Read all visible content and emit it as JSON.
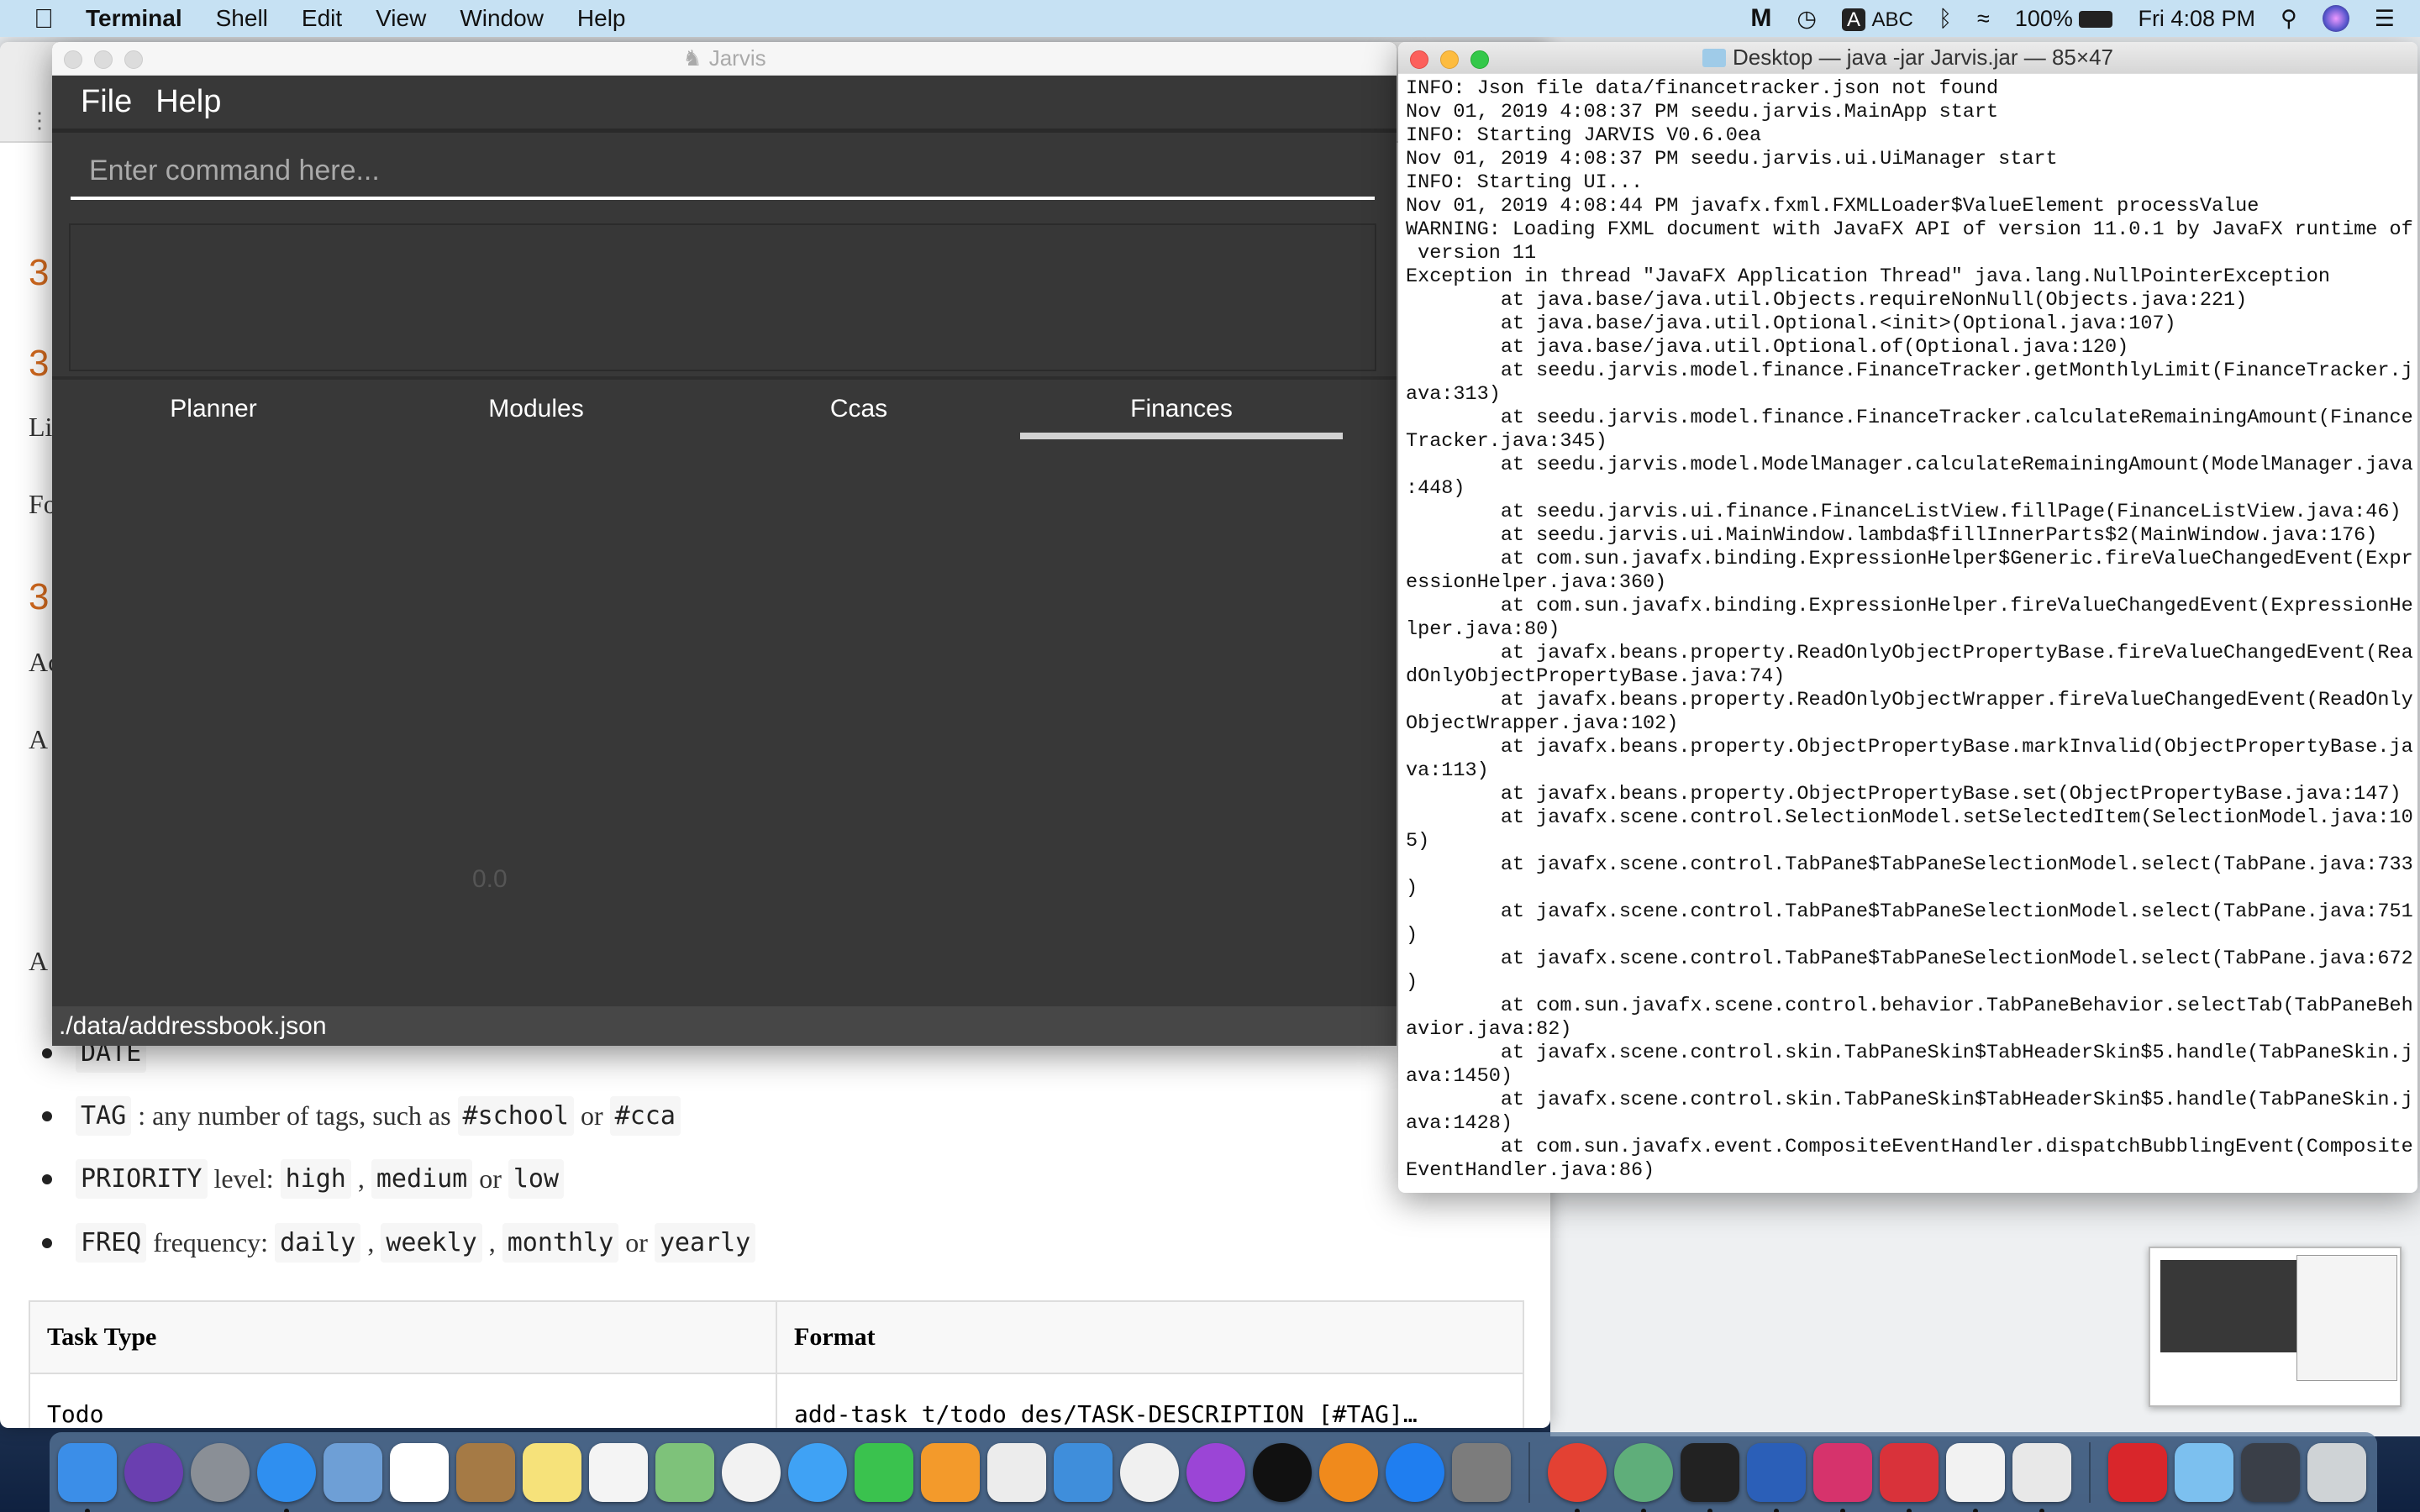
{
  "menubar": {
    "app": "Terminal",
    "items": [
      "Shell",
      "Edit",
      "View",
      "Window",
      "Help"
    ],
    "input_badge": "A",
    "input_source": "ABC",
    "battery": "100%",
    "clock": "Fri 4:08 PM"
  },
  "doc": {
    "partial_lines": [
      {
        "t": "3",
        "h": true
      },
      {
        "t": "3",
        "h": true
      },
      {
        "t": "Li"
      },
      {
        "t": "Fo"
      },
      {
        "t": "3",
        "h": true
      },
      {
        "t": "Ac"
      },
      {
        "t": "A"
      },
      {
        "t": "A"
      }
    ],
    "bullets": [
      [
        {
          "t": "DATE",
          "code": true
        }
      ],
      [
        {
          "t": "TAG",
          "code": true
        },
        {
          "t": " : any number of tags, such as "
        },
        {
          "t": "#school",
          "code": true
        },
        {
          "t": " or "
        },
        {
          "t": "#cca",
          "code": true
        }
      ],
      [
        {
          "t": "PRIORITY",
          "code": true
        },
        {
          "t": " level: "
        },
        {
          "t": "high",
          "code": true
        },
        {
          "t": " , "
        },
        {
          "t": "medium",
          "code": true
        },
        {
          "t": " or "
        },
        {
          "t": "low",
          "code": true
        }
      ],
      [
        {
          "t": "FREQ",
          "code": true
        },
        {
          "t": " frequency: "
        },
        {
          "t": "daily",
          "code": true
        },
        {
          "t": " , "
        },
        {
          "t": "weekly",
          "code": true
        },
        {
          "t": " , "
        },
        {
          "t": "monthly",
          "code": true
        },
        {
          "t": " or "
        },
        {
          "t": "yearly",
          "code": true
        }
      ]
    ],
    "table": {
      "headers": [
        "Task Type",
        "Format"
      ],
      "rows": [
        [
          "Todo",
          "add-task t/todo des/TASK-DESCRIPTION [#TAG]…"
        ]
      ]
    }
  },
  "jarvis": {
    "title": "Jarvis",
    "menu": [
      "File",
      "Help"
    ],
    "command_placeholder": "Enter command here...",
    "tabs": [
      "Planner",
      "Modules",
      "Ccas",
      "Finances"
    ],
    "selected_tab": "Finances",
    "finance_value": "0.0",
    "status_path": "./data/addressbook.json"
  },
  "terminal": {
    "title": "Desktop — java -jar Jarvis.jar — 85×47",
    "lines": [
      "INFO: Json file data/financetracker.json not found",
      "Nov 01, 2019 4:08:37 PM seedu.jarvis.MainApp start",
      "INFO: Starting JARVIS V0.6.0ea",
      "Nov 01, 2019 4:08:37 PM seedu.jarvis.ui.UiManager start",
      "INFO: Starting UI...",
      "Nov 01, 2019 4:08:44 PM javafx.fxml.FXMLLoader$ValueElement processValue",
      "WARNING: Loading FXML document with JavaFX API of version 11.0.1 by JavaFX runtime of",
      " version 11",
      "Exception in thread \"JavaFX Application Thread\" java.lang.NullPointerException",
      "        at java.base/java.util.Objects.requireNonNull(Objects.java:221)",
      "        at java.base/java.util.Optional.<init>(Optional.java:107)",
      "        at java.base/java.util.Optional.of(Optional.java:120)",
      "        at seedu.jarvis.model.finance.FinanceTracker.getMonthlyLimit(FinanceTracker.j",
      "ava:313)",
      "        at seedu.jarvis.model.finance.FinanceTracker.calculateRemainingAmount(Finance",
      "Tracker.java:345)",
      "        at seedu.jarvis.model.ModelManager.calculateRemainingAmount(ModelManager.java",
      ":448)",
      "        at seedu.jarvis.ui.finance.FinanceListView.fillPage(FinanceListView.java:46)",
      "        at seedu.jarvis.ui.MainWindow.lambda$fillInnerParts$2(MainWindow.java:176)",
      "        at com.sun.javafx.binding.ExpressionHelper$Generic.fireValueChangedEvent(Expr",
      "essionHelper.java:360)",
      "        at com.sun.javafx.binding.ExpressionHelper.fireValueChangedEvent(ExpressionHe",
      "lper.java:80)",
      "        at javafx.beans.property.ReadOnlyObjectPropertyBase.fireValueChangedEvent(Rea",
      "dOnlyObjectPropertyBase.java:74)",
      "        at javafx.beans.property.ReadOnlyObjectWrapper.fireValueChangedEvent(ReadOnly",
      "ObjectWrapper.java:102)",
      "        at javafx.beans.property.ObjectPropertyBase.markInvalid(ObjectPropertyBase.ja",
      "va:113)",
      "        at javafx.beans.property.ObjectPropertyBase.set(ObjectPropertyBase.java:147)",
      "        at javafx.scene.control.SelectionModel.setSelectedItem(SelectionModel.java:10",
      "5)",
      "        at javafx.scene.control.TabPane$TabPaneSelectionModel.select(TabPane.java:733",
      ")",
      "        at javafx.scene.control.TabPane$TabPaneSelectionModel.select(TabPane.java:751",
      ")",
      "        at javafx.scene.control.TabPane$TabPaneSelectionModel.select(TabPane.java:672",
      ")",
      "        at com.sun.javafx.scene.control.behavior.TabPaneBehavior.selectTab(TabPaneBeh",
      "avior.java:82)",
      "        at javafx.scene.control.skin.TabPaneSkin$TabHeaderSkin$5.handle(TabPaneSkin.j",
      "ava:1450)",
      "        at javafx.scene.control.skin.TabPaneSkin$TabHeaderSkin$5.handle(TabPaneSkin.j",
      "ava:1428)",
      "        at com.sun.javafx.event.CompositeEventHandler.dispatchBubblingEvent(Composite",
      "EventHandler.java:86)"
    ]
  },
  "dock": {
    "groups": [
      [
        {
          "icon": "finder",
          "color": "#3b8ee8",
          "running": true
        },
        {
          "icon": "siri",
          "color": "#6a3fb0",
          "round": true
        },
        {
          "icon": "launchpad",
          "color": "#8a8f96",
          "round": true
        },
        {
          "icon": "safari",
          "color": "#2f8ff0",
          "round": true,
          "running": true
        },
        {
          "icon": "mail",
          "color": "#6e9fd6"
        },
        {
          "icon": "calendar",
          "color": "#ffffff"
        },
        {
          "icon": "contacts",
          "color": "#a57a45"
        },
        {
          "icon": "notes",
          "color": "#f6e27a"
        },
        {
          "icon": "reminders",
          "color": "#f4f4f4"
        },
        {
          "icon": "maps",
          "color": "#7ec27a"
        },
        {
          "icon": "photos",
          "color": "#f2f2f2",
          "round": true
        },
        {
          "icon": "messages",
          "color": "#3fa2f5",
          "round": true
        },
        {
          "icon": "facetime",
          "color": "#3ac24e"
        },
        {
          "icon": "pages",
          "color": "#f39a2b"
        },
        {
          "icon": "numbers",
          "color": "#ececec"
        },
        {
          "icon": "keynote",
          "color": "#3f8edb"
        },
        {
          "icon": "music",
          "color": "#f0f0f0",
          "round": true
        },
        {
          "icon": "podcasts",
          "color": "#9b45d6",
          "round": true
        },
        {
          "icon": "tv",
          "color": "#111111",
          "round": true
        },
        {
          "icon": "books",
          "color": "#f08a1c",
          "round": true
        },
        {
          "icon": "app-store",
          "color": "#1f7ef0",
          "round": true
        },
        {
          "icon": "system-preferences",
          "color": "#7c7c7c"
        }
      ],
      [
        {
          "icon": "chrome",
          "color": "#e34133",
          "round": true,
          "running": true
        },
        {
          "icon": "atom",
          "color": "#5fae7a",
          "round": true,
          "running": true
        },
        {
          "icon": "terminal",
          "color": "#222222",
          "running": true
        },
        {
          "icon": "word",
          "color": "#2b5fb8",
          "running": true
        },
        {
          "icon": "intellij",
          "color": "#d6336c",
          "running": true
        },
        {
          "icon": "angular",
          "color": "#d9323a",
          "running": true
        },
        {
          "icon": "textedit",
          "color": "#f2f2f2",
          "running": true
        },
        {
          "icon": "preview",
          "color": "#e8e8e8",
          "running": true
        }
      ],
      [
        {
          "icon": "stop",
          "color": "#d9262b"
        },
        {
          "icon": "downloads-folder",
          "color": "#7cc0ef"
        },
        {
          "icon": "screenshot",
          "color": "#3a3f48"
        },
        {
          "icon": "trash",
          "color": "#cfd3d6"
        }
      ]
    ]
  }
}
